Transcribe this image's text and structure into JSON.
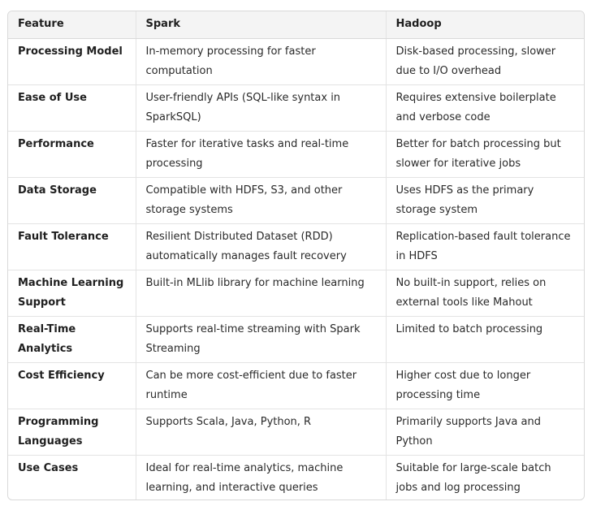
{
  "table": {
    "headers": [
      "Feature",
      "Spark",
      "Hadoop"
    ],
    "rows": [
      {
        "feature": "Processing Model",
        "spark": "In-memory processing for faster computation",
        "hadoop": "Disk-based processing, slower due to I/O overhead"
      },
      {
        "feature": "Ease of Use",
        "spark": "User-friendly APIs (SQL-like syntax in SparkSQL)",
        "hadoop": "Requires extensive boilerplate and verbose code"
      },
      {
        "feature": "Performance",
        "spark": "Faster for iterative tasks and real-time processing",
        "hadoop": "Better for batch processing but slower for iterative jobs"
      },
      {
        "feature": "Data Storage",
        "spark": "Compatible with HDFS, S3, and other storage systems",
        "hadoop": "Uses HDFS as the primary storage system"
      },
      {
        "feature": "Fault Tolerance",
        "spark": "Resilient Distributed Dataset (RDD) automatically manages fault recovery",
        "hadoop": "Replication-based fault tolerance in HDFS"
      },
      {
        "feature": "Machine Learning Support",
        "spark": "Built-in MLlib library for machine learning",
        "hadoop": "No built-in support, relies on external tools like Mahout"
      },
      {
        "feature": "Real-Time Analytics",
        "spark": "Supports real-time streaming with Spark Streaming",
        "hadoop": "Limited to batch processing"
      },
      {
        "feature": "Cost Efficiency",
        "spark": "Can be more cost-efficient due to faster runtime",
        "hadoop": "Higher cost due to longer processing time"
      },
      {
        "feature": "Programming Languages",
        "spark": "Supports Scala, Java, Python, R",
        "hadoop": "Primarily supports Java and Python"
      },
      {
        "feature": "Use Cases",
        "spark": "Ideal for real-time analytics, machine learning, and interactive queries",
        "hadoop": "Suitable for large-scale batch jobs and log processing"
      }
    ]
  }
}
